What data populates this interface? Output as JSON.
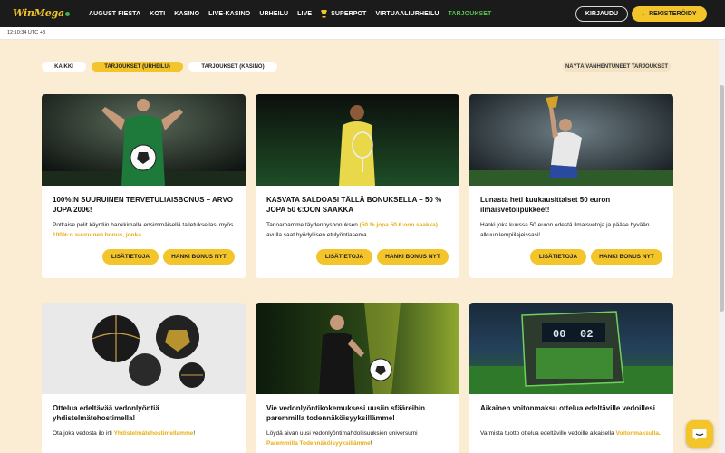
{
  "header": {
    "logo_win": "Win",
    "logo_mega": "Mega",
    "nav": [
      {
        "label": "AUGUST FIESTA"
      },
      {
        "label": "KOTI"
      },
      {
        "label": "KASINO"
      },
      {
        "label": "LIVE-KASINO"
      },
      {
        "label": "URHEILU"
      },
      {
        "label": "LIVE"
      },
      {
        "label": "SUPERPOT",
        "icon": "trophy-icon"
      },
      {
        "label": "VIRTUAALIURHEILU"
      },
      {
        "label": "TARJOUKSET",
        "active": true
      }
    ],
    "login_label": "KIRJAUDU",
    "register_label": "REKISTERÖIDY"
  },
  "time": "12:10:34 UTC +3",
  "filters": {
    "all": "KAIKKI",
    "sports": "TARJOUKSET (URHEILU)",
    "casino": "TARJOUKSET (KASINO)",
    "expired": "NÄYTÄ VANHENTUNEET TARJOUKSET"
  },
  "cards": [
    {
      "title": "100%:N SUURUINEN TERVETULIAISBONUS – ARVO JOPA 200€!",
      "desc_pre": "Potkaise pelit käyntiin hankkimalla ensimmäisellä talletuksellasi myös ",
      "desc_hl": "100%:n suuruinen bonus, jonka…",
      "desc_post": "",
      "more": "LISÄTIETOJA",
      "bonus": "HANKI BONUS NYT"
    },
    {
      "title": "KASVATA SALDOASI TÄLLÄ BONUKSELLA – 50 % JOPA 50 €:OON SAAKKA",
      "desc_pre": "Tarjoamamme täydennysbonuksen ",
      "desc_hl": "(50 % jopa 50 €:oon saakka)",
      "desc_post": " avulla saat hyödyllisen etulyöntiasema…",
      "more": "LISÄTIETOJA",
      "bonus": "HANKI BONUS NYT"
    },
    {
      "title": "Lunasta heti kuukausittaiset 50 euron ilmaisvetolipukkeet!",
      "desc_pre": "Hanki joka kuussa 50 euron edestä ilmaisvetoja ja pääse hyvään alkuun lempiilajeissasi!",
      "desc_hl": "",
      "desc_post": "",
      "more": "LISÄTIETOJA",
      "bonus": "HANKI BONUS NYT"
    },
    {
      "title": "Ottelua edeltävää vedonlyöntiä yhdistelmätehostimella!",
      "desc_pre": "Ota joka vedosta ilo irti ",
      "desc_hl": "Yhdistelmätehostimellamme",
      "desc_post": "!",
      "more": "",
      "bonus": ""
    },
    {
      "title": "Vie vedonlyöntikokemuksesi uusiin sfääreihin paremmilla todennäköisyyksillämme!",
      "desc_pre": "Löydä aivan uusi vedonlyöntimahdollisuuksien universumi ",
      "desc_hl": "Paremmilla Todennäköisyyksillämme",
      "desc_post": "!",
      "more": "",
      "bonus": ""
    },
    {
      "title": "Aikainen voitonmaksu ottelua edeltäville vedoillesi",
      "desc_pre": "Varmista tuotto ottelua edeltäville vedoille aikaisella ",
      "desc_hl": "Voitonmaksulla",
      "desc_post": ".",
      "more": "",
      "bonus": ""
    }
  ],
  "scoreboard": {
    "left": "00",
    "right": "02"
  },
  "colors": {
    "accent": "#f3c52b",
    "active_nav": "#56c04f",
    "background": "#fbecd4",
    "header": "#1b1b1b"
  }
}
